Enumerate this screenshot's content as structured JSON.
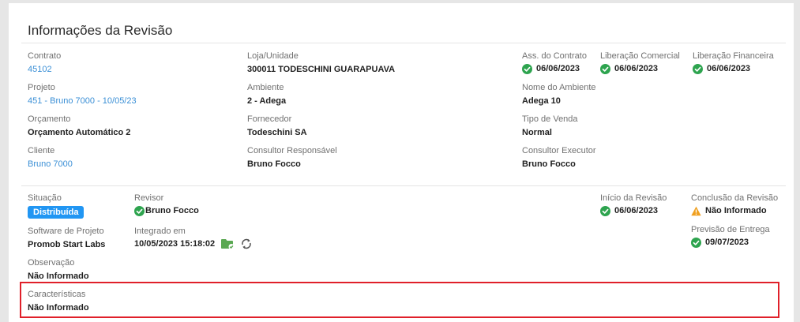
{
  "section": {
    "title": "Informações da Revisão"
  },
  "contract_info": {
    "contrato": {
      "label": "Contrato",
      "value": "45102"
    },
    "projeto": {
      "label": "Projeto",
      "value": "451 - Bruno 7000 - 10/05/23"
    },
    "orcamento": {
      "label": "Orçamento",
      "value": "Orçamento Automático 2"
    },
    "cliente": {
      "label": "Cliente",
      "value": "Bruno 7000"
    },
    "loja": {
      "label": "Loja/Unidade",
      "value": "300011 TODESCHINI GUARAPUAVA"
    },
    "ambiente": {
      "label": "Ambiente",
      "value": "2 - Adega"
    },
    "fornecedor": {
      "label": "Fornecedor",
      "value": "Todeschini SA"
    },
    "consultor_responsavel": {
      "label": "Consultor Responsável",
      "value": "Bruno Focco"
    },
    "ass_contrato": {
      "label": "Ass. do Contrato",
      "value": "06/06/2023",
      "icon": "check-circle-icon"
    },
    "liberacao_comercial": {
      "label": "Liberação Comercial",
      "value": "06/06/2023",
      "icon": "check-circle-icon"
    },
    "liberacao_financeira": {
      "label": "Liberação Financeira",
      "value": "06/06/2023",
      "icon": "check-circle-icon"
    },
    "nome_ambiente": {
      "label": "Nome do Ambiente",
      "value": "Adega 10"
    },
    "tipo_venda": {
      "label": "Tipo de Venda",
      "value": "Normal"
    },
    "consultor_executor": {
      "label": "Consultor Executor",
      "value": "Bruno Focco"
    }
  },
  "revision": {
    "situacao": {
      "label": "Situação",
      "value": "Distribuída"
    },
    "revisor": {
      "label": "Revisor",
      "value": "Bruno Focco",
      "icon": "check-circle-icon"
    },
    "software": {
      "label": "Software de Projeto",
      "value": "Promob Start Labs"
    },
    "integrado": {
      "label": "Integrado em",
      "value": "10/05/2023 15:18:02",
      "icons": [
        "folder-check-icon",
        "sync-icon"
      ]
    },
    "observacao": {
      "label": "Observação",
      "value": "Não Informado"
    },
    "caracteristicas": {
      "label": "Características",
      "value": "Não Informado"
    },
    "inicio_revisao": {
      "label": "Início da Revisão",
      "value": "06/06/2023",
      "icon": "check-circle-icon"
    },
    "conclusao_revisao": {
      "label": "Conclusão da Revisão",
      "value": "Não Informado",
      "icon": "warning-icon"
    },
    "previsao_entrega": {
      "label": "Previsão de Entrega",
      "value": "09/07/2023",
      "icon": "check-circle-icon"
    }
  },
  "colors": {
    "success": "#2ea44f",
    "warning": "#f0a020",
    "link": "#3a8fd6",
    "badge": "#2196f3",
    "highlight": "#e0202a"
  }
}
